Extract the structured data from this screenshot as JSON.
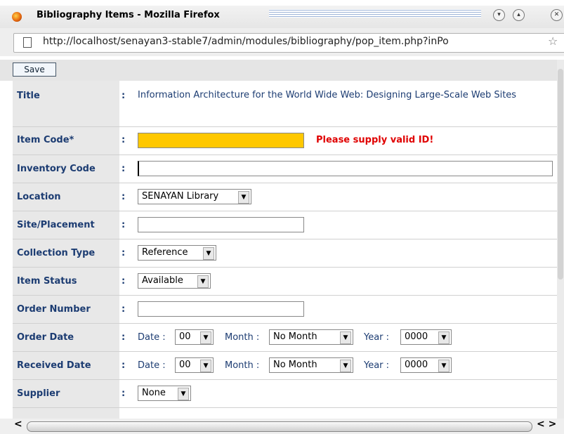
{
  "window": {
    "title": "Bibliography Items - Mozilla Firefox",
    "url": "http://localhost/senayan3-stable7/admin/modules/bibliography/pop_item.php?inPo"
  },
  "toolbar": {
    "save_label": "Save"
  },
  "form": {
    "colon": ":",
    "title": {
      "label": "Title",
      "value": "Information Architecture for the World Wide Web: Designing Large-Scale Web Sites"
    },
    "item_code": {
      "label": "Item Code*",
      "value": "",
      "error": "Please supply valid ID!"
    },
    "inventory_code": {
      "label": "Inventory Code",
      "value": ""
    },
    "location": {
      "label": "Location",
      "selected": "SENAYAN Library"
    },
    "site_placement": {
      "label": "Site/Placement",
      "value": ""
    },
    "collection_type": {
      "label": "Collection Type",
      "selected": "Reference"
    },
    "item_status": {
      "label": "Item Status",
      "selected": "Available"
    },
    "order_number": {
      "label": "Order Number",
      "value": ""
    },
    "order_date": {
      "label": "Order Date",
      "date_label": "Date :",
      "date": "00",
      "month_label": "Month :",
      "month": "No Month",
      "year_label": "Year :",
      "year": "0000"
    },
    "received_date": {
      "label": "Received Date",
      "date_label": "Date :",
      "date": "00",
      "month_label": "Month :",
      "month": "No Month",
      "year_label": "Year :",
      "year": "0000"
    },
    "supplier": {
      "label": "Supplier",
      "selected": "None"
    }
  },
  "colors": {
    "label": "#1c3c72",
    "error": "#e00000",
    "error_field": "#ffc800"
  }
}
